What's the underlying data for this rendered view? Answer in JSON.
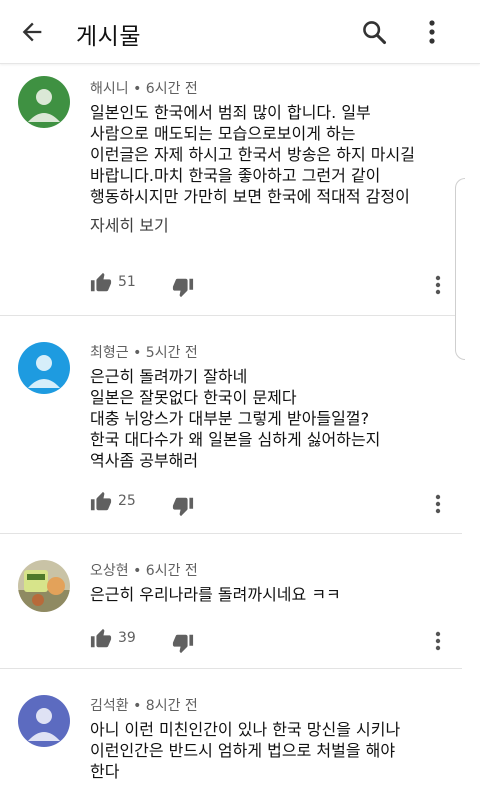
{
  "header": {
    "title": "게시물"
  },
  "comments": [
    {
      "meta": "해시니 • 6시간 전",
      "lines": [
        "일본인도 한국에서 범죄 많이 합니다. 일부",
        "사람으로 매도되는 모습으로보이게 하는",
        "이런글은 자제 하시고 한국서 방송은 하지 마시길",
        "바랍니다.마치 한국을 좋아하고 그런거 같이",
        "행동하시지만 가만히 보면 한국에 적대적 감정이"
      ],
      "read_more": "자세히 보기",
      "likes": "51",
      "avatar_color": "#3f9142"
    },
    {
      "meta": "최형근 • 5시간 전",
      "lines": [
        "은근히 돌려까기  잘하네",
        "일본은 잘못없다 한국이 문제다",
        "대충 뉘앙스가  대부분 그렇게 받아들일껄?",
        "한국 대다수가 왜 일본을 심하게 싫어하는지",
        "역사좀 공부해러"
      ],
      "likes": "25",
      "avatar_color": "#1e9be0"
    },
    {
      "meta": "오상현 • 6시간 전",
      "lines": [
        "은근히 우리나라를 돌려까시네요 ㅋㅋ"
      ],
      "likes": "39",
      "avatar_color": "#a8b66a"
    },
    {
      "meta": "김석환 • 8시간 전",
      "lines": [
        "아니 이런 미친인간이 있나 한국 망신을 시키나",
        "이런인간은 반드시 엄하게 법으로 처벌을 해야",
        "한다"
      ],
      "avatar_color": "#5c6bc0"
    }
  ]
}
